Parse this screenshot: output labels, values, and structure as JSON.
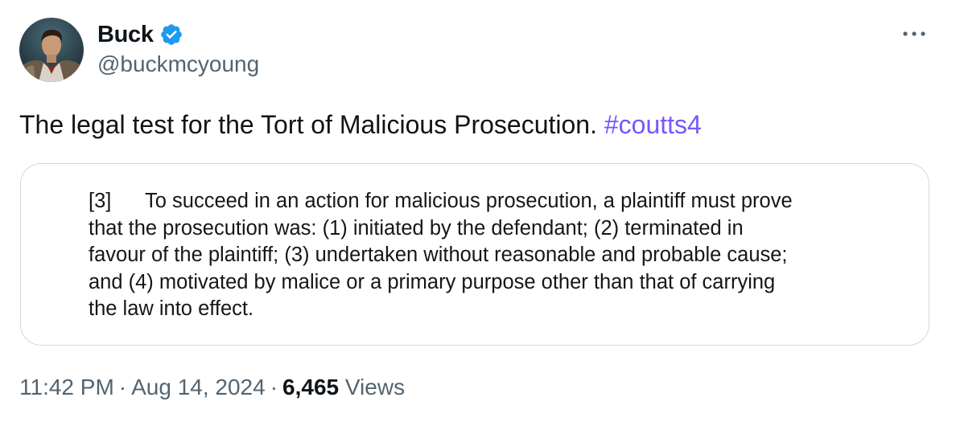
{
  "author": {
    "display_name": "Buck",
    "handle": "@buckmcyoung",
    "verified_color": "#1d9bf0"
  },
  "tweet": {
    "text": "The legal test for the Tort of Malicious Prosecution.",
    "hashtag": "#coutts4",
    "hashtag_color": "#7856ff"
  },
  "quote_card": {
    "paragraph_number": "[3]",
    "lines": [
      "To succeed in an action for malicious prosecution, a plaintiff must prove",
      "that the prosecution was: (1) initiated by the defendant; (2) terminated in",
      "favour of the plaintiff; (3) undertaken without reasonable and probable cause;",
      "and (4) motivated by malice or a primary purpose other than that of carrying",
      "the law into effect."
    ]
  },
  "meta": {
    "time": "11:42 PM",
    "separator": "·",
    "date": "Aug 14, 2024",
    "views_count": "6,465",
    "views_label": "Views"
  },
  "icons": {
    "more": "more-horizontal-icon",
    "verified": "verified-badge-icon"
  }
}
